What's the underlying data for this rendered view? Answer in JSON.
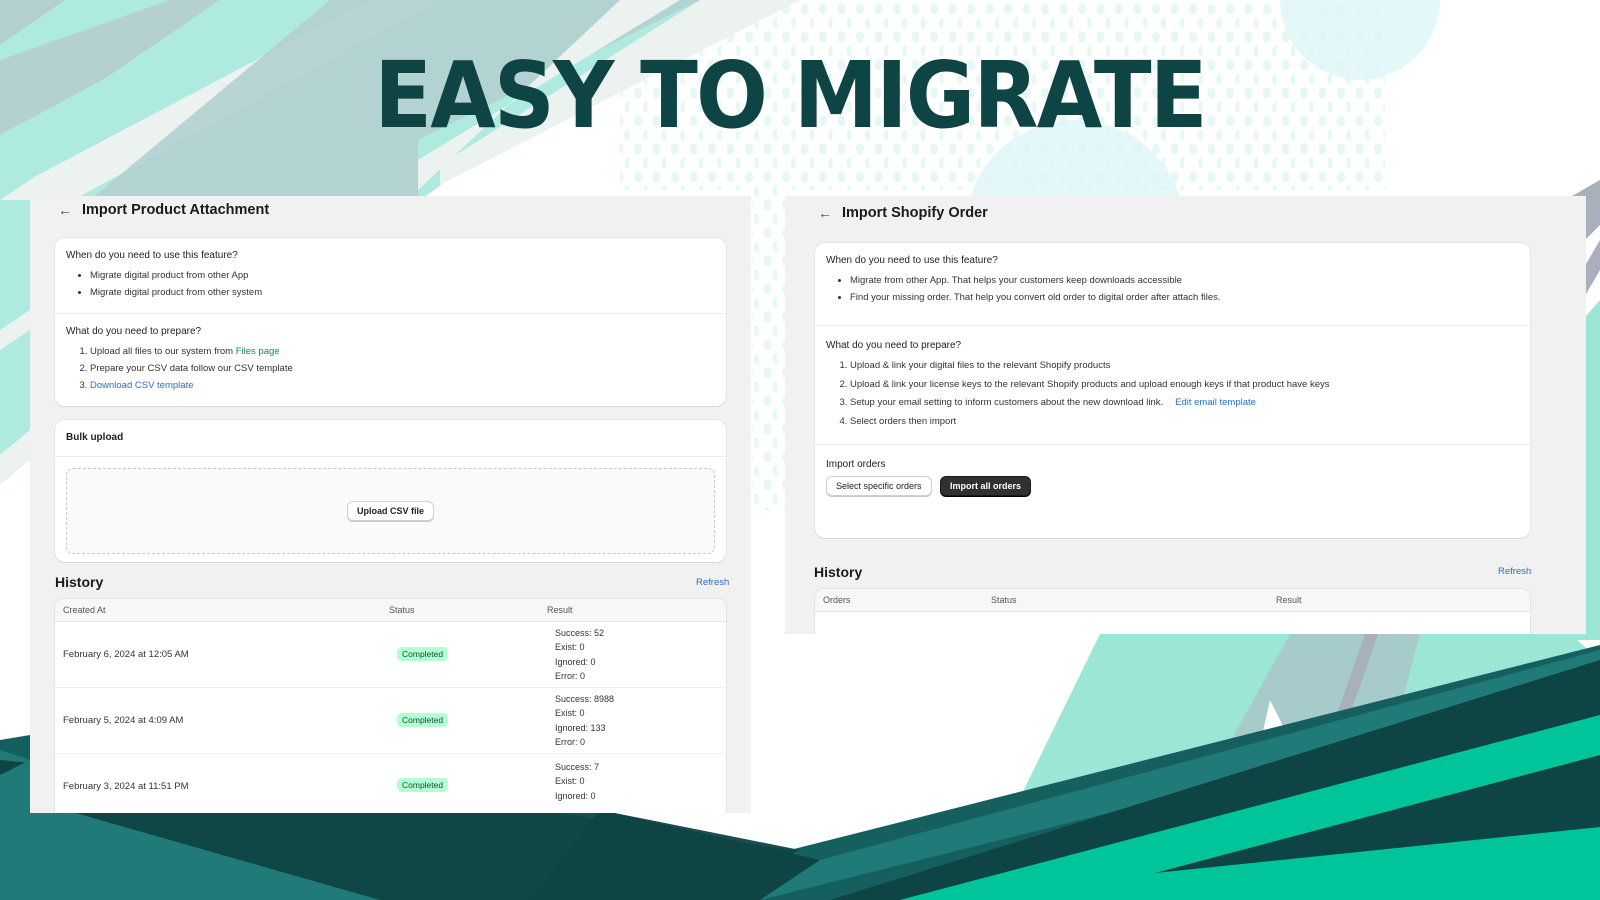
{
  "headline": "EASY TO MIGRATE",
  "colors": {
    "headline": "#0f4444",
    "mint": "#aeeadf",
    "teal_dark": "#0f4444",
    "teal_mid": "#207a78",
    "green_bright": "#00c49a",
    "panel_bg": "#f1f1f1",
    "badge_bg": "#b4fed2",
    "link_blue": "#2c6ecb",
    "link_green": "#138a5c"
  },
  "left_panel": {
    "back_icon": "arrow-left-icon",
    "title": "Import Product Attachment",
    "when": {
      "title": "When do you need to use this feature?",
      "items": [
        "Migrate digital product from other App",
        "Migrate digital product from other system"
      ]
    },
    "prepare": {
      "title": "What do you need to prepare?",
      "step1_text": "Upload all files to our system from ",
      "step1_link": "Files page",
      "step2_text": "Prepare your CSV data follow our CSV template",
      "step3_link": "Download CSV template"
    },
    "bulk": {
      "title": "Bulk upload",
      "upload_button": "Upload CSV file"
    },
    "history": {
      "title": "History",
      "refresh": "Refresh",
      "columns": [
        "Created At",
        "Status",
        "Result"
      ],
      "rows": [
        {
          "created_at": "February 6, 2024 at 12:05 AM",
          "status": "Completed",
          "result": [
            "Success: 52",
            "Exist: 0",
            "Ignored: 0",
            "Error: 0"
          ]
        },
        {
          "created_at": "February 5, 2024 at 4:09 AM",
          "status": "Completed",
          "result": [
            "Success: 8988",
            "Exist: 0",
            "Ignored: 133",
            "Error: 0"
          ]
        },
        {
          "created_at": "February 3, 2024 at 11:51 PM",
          "status": "Completed",
          "result": [
            "Success: 7",
            "Exist: 0",
            "Ignored: 0"
          ]
        }
      ]
    }
  },
  "right_panel": {
    "back_icon": "arrow-left-icon",
    "title": "Import Shopify Order",
    "when": {
      "title": "When do you need to use this feature?",
      "items": [
        "Migrate from other App. That helps your customers keep downloads accessible",
        "Find your missing order. That help you convert old order to digital order after attach files."
      ]
    },
    "prepare": {
      "title": "What do you need to prepare?",
      "steps": [
        "Upload & link your digital files to the relevant Shopify products",
        "Upload & link your license keys to the relevant Shopify products and upload enough keys if that product have keys",
        "Setup your email setting to inform customers about the new download link.",
        "Select orders then import"
      ],
      "step3_link": "Edit email template"
    },
    "import": {
      "title": "Import orders",
      "select_button": "Select specific orders",
      "import_all_button": "Import all orders"
    },
    "history": {
      "title": "History",
      "refresh": "Refresh",
      "columns": [
        "Orders",
        "Status",
        "Result"
      ]
    }
  }
}
